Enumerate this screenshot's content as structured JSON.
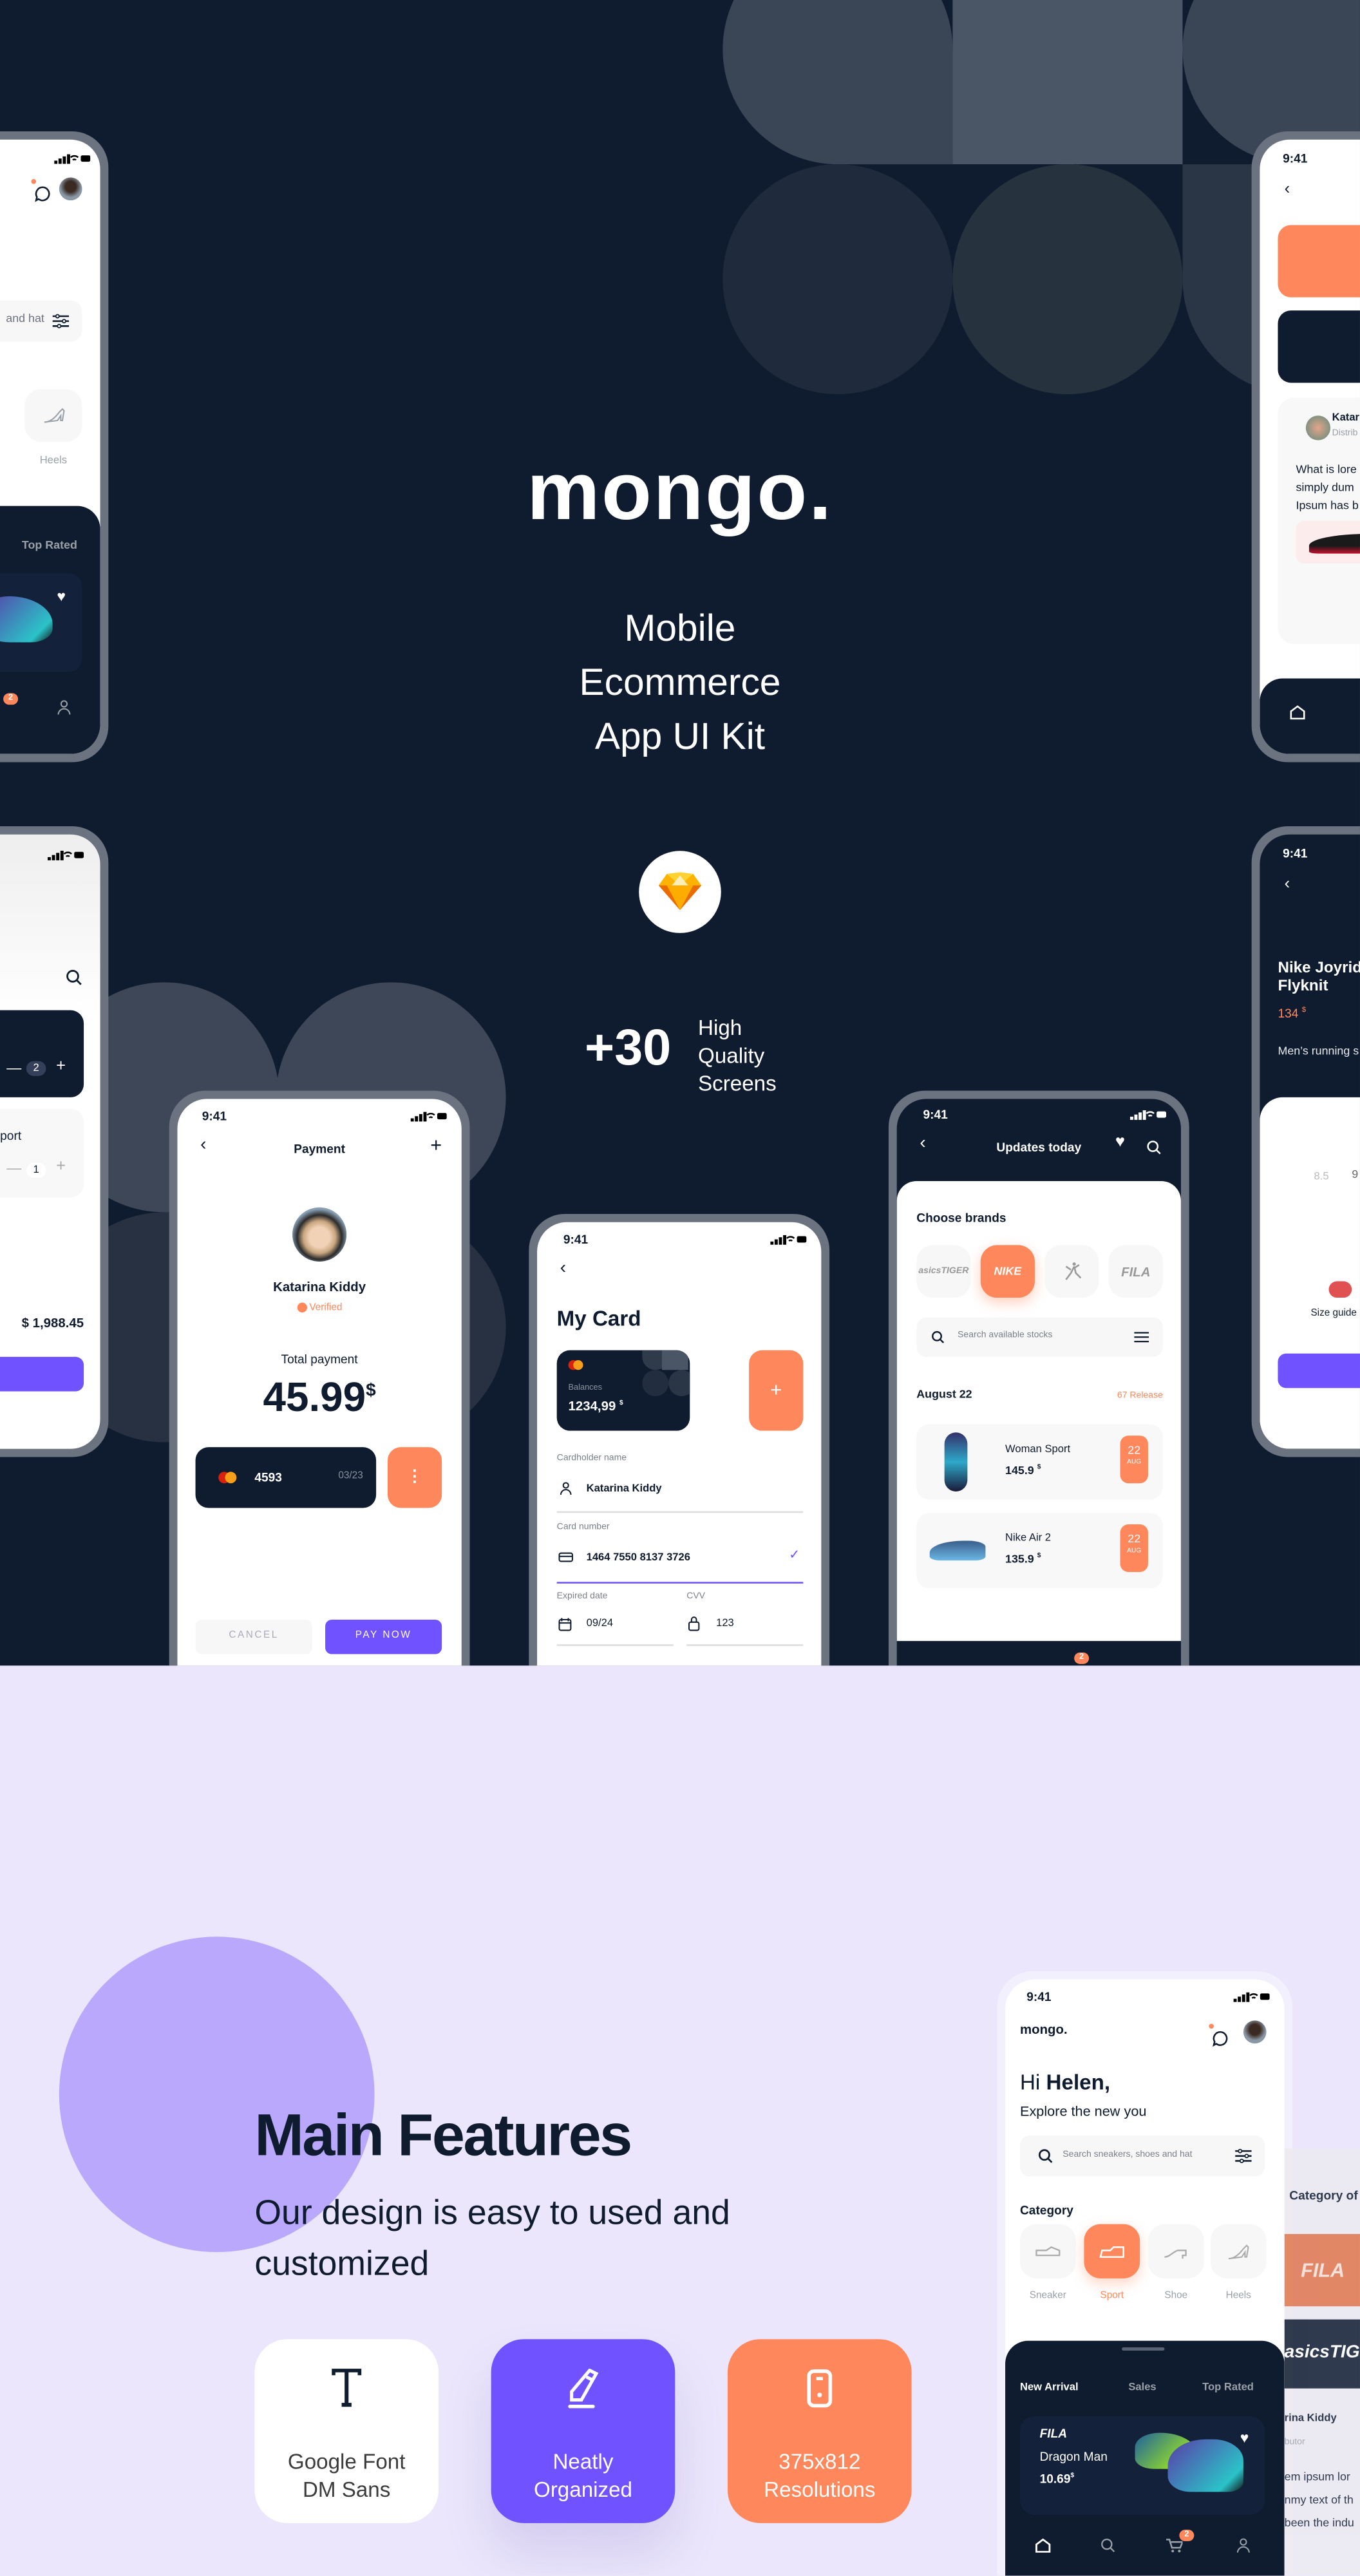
{
  "colors": {
    "dark": "#0f1c2f",
    "orange": "#ff875c",
    "purple": "#7152ff",
    "lavender": "#ebe6fc",
    "frame": "#6b7380"
  },
  "hero": {
    "logo": "mongo.",
    "subtitle_lines": [
      "Mobile",
      "Ecommerce",
      "App UI Kit"
    ],
    "tool_icon": "sketch-diamond-icon",
    "count": "+30",
    "count_label_lines": [
      "High",
      "Quality",
      "Screens"
    ]
  },
  "phones": {
    "home_partial": {
      "search_text": "and hat",
      "category_label": "Heels",
      "tab": "Top Rated",
      "cart_badge": "2"
    },
    "cart_partial": {
      "item1_name": "s",
      "item1_qty": "2",
      "item2_name": "Sport",
      "item2_qty": "1",
      "total": "$ 1,988.45"
    },
    "review_partial": {
      "time": "9:41",
      "author": "Katar",
      "role": "Distrib",
      "lines": [
        "What is lore",
        "simply dum",
        "Ipsum has b"
      ]
    },
    "product_partial": {
      "time": "9:41",
      "title_lines": [
        "Nike Joyrid",
        "Flyknit"
      ],
      "price": "134",
      "currency": "$",
      "subtitle": "Men’s running s",
      "sizes": [
        "8.5",
        "9"
      ],
      "size_guide": "Size guide"
    },
    "payment": {
      "time": "9:41",
      "title": "Payment",
      "name": "Katarina Kiddy",
      "verified": "Verified",
      "total_label": "Total payment",
      "amount": "45.99",
      "currency": "$",
      "card_last4": "4593",
      "card_expiry": "03/23",
      "cancel": "CANCEL",
      "pay": "PAY NOW"
    },
    "my_card": {
      "time": "9:41",
      "title": "My Card",
      "balance_label": "Balances",
      "balance": "1234,99",
      "currency": "$",
      "cardholder_label": "Cardholder name",
      "cardholder": "Katarina Kiddy",
      "card_number_label": "Card number",
      "card_number": "1464 7550 8137 3726",
      "expiry_label": "Expired date",
      "expiry": "09/24",
      "cvv_label": "CVV",
      "cvv": "123"
    },
    "updates": {
      "time": "9:41",
      "title": "Updates today",
      "brands_heading": "Choose brands",
      "brands": [
        "asicsTIGER",
        "NIKE",
        "FILA"
      ],
      "selected_brand": "NIKE",
      "search_placeholder": "Search available stocks",
      "date": "August 22",
      "release": "67 Release",
      "items": [
        {
          "name": "Woman Sport",
          "price": "145.9",
          "currency": "$",
          "day": "22",
          "month": "AUG"
        },
        {
          "name": "Nike Air 2",
          "price": "135.9",
          "currency": "$",
          "day": "22",
          "month": "AUG"
        }
      ],
      "cart_badge": "2"
    },
    "home": {
      "time": "9:41",
      "logo": "mongo.",
      "greeting_prefix": "Hi",
      "greeting_name": "Helen,",
      "tagline": "Explore the new you",
      "search_placeholder": "Search sneakers, shoes and hat",
      "category_heading": "Category",
      "categories": [
        {
          "label": "Sneaker",
          "selected": false
        },
        {
          "label": "Sport",
          "selected": true
        },
        {
          "label": "Shoe",
          "selected": false
        },
        {
          "label": "Heels",
          "selected": false
        }
      ],
      "tabs": [
        "New Arrival",
        "Sales",
        "Top Rated"
      ],
      "active_tab": "New Arrival",
      "product": {
        "brand": "FILA",
        "name": "Dragon Man",
        "price": "10.69",
        "currency": "$"
      },
      "cart_badge": "2"
    },
    "category_partial": {
      "heading": "Category of",
      "brands": [
        "FILA",
        "asicsTIGE"
      ],
      "author": "rina Kiddy",
      "role": "butor",
      "lines": [
        "em ipsum lor",
        "nmy text of th",
        "been the indu"
      ]
    }
  },
  "features": {
    "heading": "Main Features",
    "subtitle_lines": [
      "Our design is easy to used and",
      "customized"
    ],
    "cards": [
      {
        "icon": "text-type-icon",
        "lines": [
          "Google Font",
          "DM Sans"
        ]
      },
      {
        "icon": "pencil-icon",
        "lines": [
          "Neatly",
          "Organized"
        ]
      },
      {
        "icon": "mobile-phone-icon",
        "lines": [
          "375x812",
          "Resolutions"
        ]
      }
    ]
  }
}
